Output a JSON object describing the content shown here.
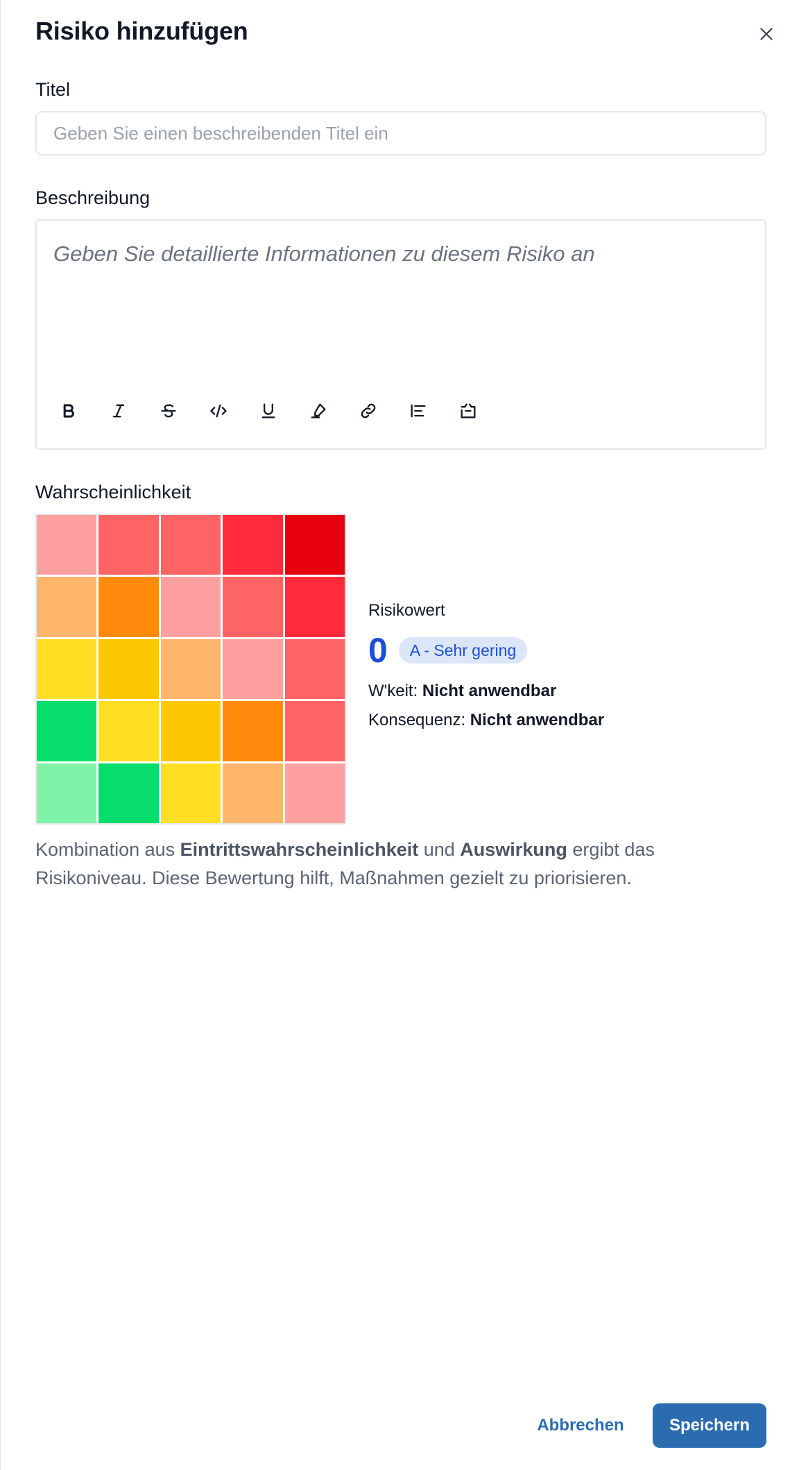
{
  "dialog": {
    "title": "Risiko hinzufügen",
    "close_icon": "close-icon"
  },
  "form": {
    "title_label": "Titel",
    "title_placeholder": "Geben Sie einen beschreibenden Titel ein",
    "title_value": "",
    "description_label": "Beschreibung",
    "description_placeholder": "Geben Sie detaillierte Informationen zu diesem Risiko an",
    "toolbar": [
      {
        "name": "bold-icon"
      },
      {
        "name": "italic-icon"
      },
      {
        "name": "strikethrough-icon"
      },
      {
        "name": "code-icon"
      },
      {
        "name": "underline-icon"
      },
      {
        "name": "highlight-icon"
      },
      {
        "name": "link-icon"
      },
      {
        "name": "align-icon"
      },
      {
        "name": "clear-format-icon"
      }
    ]
  },
  "matrix": {
    "label": "Wahrscheinlichkeit",
    "colors": [
      [
        "#ffa0a0",
        "#ff6464",
        "#ff6464",
        "#ff2b3a",
        "#e6000e"
      ],
      [
        "#ffb66b",
        "#ff8a0c",
        "#ffa0a0",
        "#ff6464",
        "#ff2b3a"
      ],
      [
        "#ffde24",
        "#fdc701",
        "#ffb66b",
        "#ffa0a0",
        "#ff6464"
      ],
      [
        "#06dd6b",
        "#ffde24",
        "#fdc701",
        "#ff8a0c",
        "#ff6464"
      ],
      [
        "#7ff3a8",
        "#06dd6b",
        "#ffde24",
        "#ffb66b",
        "#ffa0a0"
      ]
    ]
  },
  "score": {
    "label": "Risikowert",
    "value": "0",
    "badge": "A - Sehr gering",
    "likelihood_label": "W'keit:",
    "likelihood_value": "Nicht anwendbar",
    "consequence_label": "Konsequenz:",
    "consequence_value": "Nicht anwendbar"
  },
  "explanation": {
    "part1": "Kombination aus ",
    "bold1": "Eintrittswahrscheinlichkeit",
    "part2": " und ",
    "bold2": "Auswirkung",
    "part3": " ergibt das Risikoniveau. Diese Bewertung hilft, Maßnahmen gezielt zu priorisieren."
  },
  "actions": {
    "cancel": "Abbrechen",
    "save": "Speichern"
  },
  "colors": {
    "accent": "#2b6cb0",
    "score_blue": "#1d4ed8",
    "badge_bg": "#dbe6f8"
  }
}
